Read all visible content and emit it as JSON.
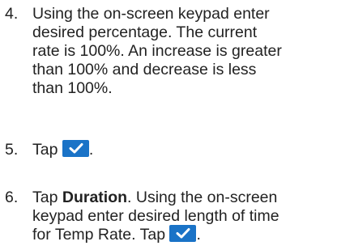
{
  "steps": [
    {
      "number": "4.",
      "lines": [
        "Using the on-screen keypad enter",
        "desired percentage. The current",
        "rate is 100%. An increase is greater",
        "than 100% and decrease is less",
        "than 100%."
      ]
    },
    {
      "number": "5.",
      "text_before": "Tap",
      "text_after": ".",
      "icon": "checkmark-icon"
    },
    {
      "number": "6.",
      "line1_prefix": "Tap ",
      "line1_bold": "Duration",
      "line1_suffix": ". Using the on-screen",
      "line2": "keypad enter desired length of time",
      "line3_before": "for Temp Rate. Tap",
      "line3_after": ".",
      "icon": "checkmark-icon"
    }
  ],
  "colors": {
    "button": "#1a73c7",
    "text": "#222222"
  }
}
